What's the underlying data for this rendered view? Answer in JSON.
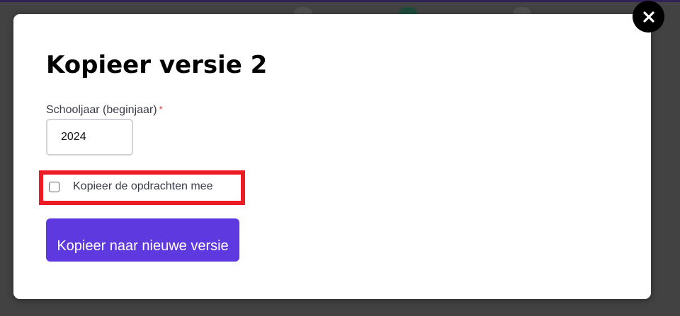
{
  "dialog": {
    "title": "Kopieer versie 2",
    "close_icon": "close-icon",
    "school_year": {
      "label": "Schooljaar (beginjaar)",
      "required_mark": "*",
      "value": "2024"
    },
    "copy_assignments": {
      "label": "Kopieer de opdrachten mee",
      "checked": false
    },
    "submit_label": "Kopieer naar nieuwe versie",
    "colors": {
      "accent": "#5f39e0",
      "highlight": "#ed1c24",
      "required": "#e0342b",
      "overlay": "#424242"
    }
  }
}
